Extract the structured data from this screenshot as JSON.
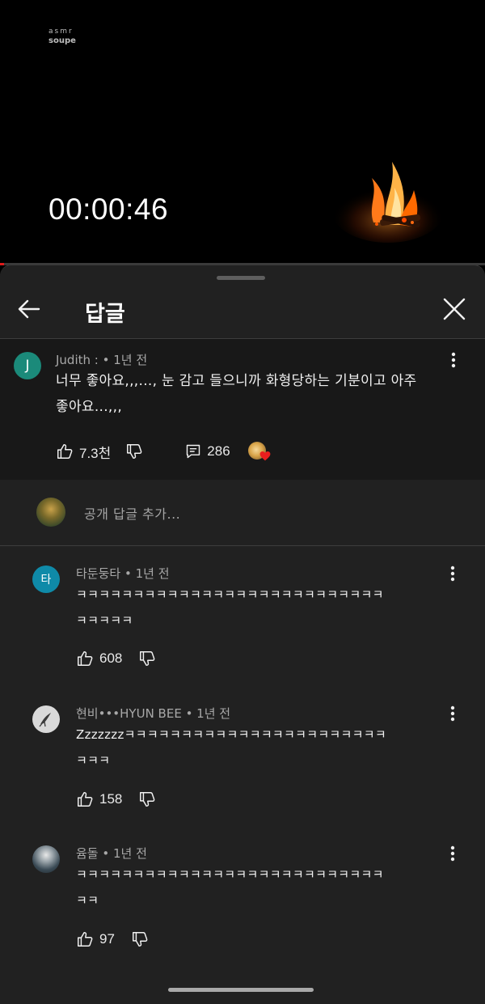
{
  "video": {
    "brand_line1": "asmr",
    "brand_line2": "soupe",
    "timer": "00:00:46"
  },
  "header": {
    "title": "답글"
  },
  "parent_comment": {
    "avatar_letter": "J",
    "avatar_color": "#1b8a7a",
    "meta": "Judith : • 1년 전",
    "text_line1": "너무 좋아요,,,..., 눈 감고 들으니까 화형당하는 기분이고 아주",
    "text_line2": "좋아요...,,,",
    "likes": "7.3천",
    "reply_count": "286"
  },
  "add_reply": {
    "placeholder": "공개 답글 추가..."
  },
  "replies": [
    {
      "avatar_letter": "타",
      "avatar_color": "#0f8aa8",
      "meta": "타둔둥타 • 1년 전",
      "text_line1": "ㅋㅋㅋㅋㅋㅋㅋㅋㅋㅋㅋㅋㅋㅋㅋㅋㅋㅋㅋㅋㅋㅋㅋㅋㅋㅋㅋ",
      "text_line2": "ㅋㅋㅋㅋㅋ",
      "likes": "608"
    },
    {
      "avatar_letter": "",
      "avatar_color": "#d9d9d9",
      "meta": "현비•••HYUN BEE • 1년 전",
      "text_line1": "Zzzzzzzㅋㅋㅋㅋㅋㅋㅋㅋㅋㅋㅋㅋㅋㅋㅋㅋㅋㅋㅋㅋㅋㅋㅋ",
      "text_line2": "ㅋㅋㅋ",
      "likes": "158"
    },
    {
      "avatar_letter": "",
      "avatar_color": "#3a4a55",
      "meta": "윰돌 • 1년 전",
      "text_line1": "ㅋㅋㅋㅋㅋㅋㅋㅋㅋㅋㅋㅋㅋㅋㅋㅋㅋㅋㅋㅋㅋㅋㅋㅋㅋㅋㅋ",
      "text_line2": "ㅋㅋ",
      "likes": "97"
    }
  ],
  "icons": {
    "back": "back-arrow-icon",
    "close": "close-icon",
    "like": "thumbs-up-icon",
    "dislike": "thumbs-down-icon",
    "reply": "comment-icon",
    "more": "more-vert-icon",
    "creator_heart": "creator-heart-icon"
  },
  "colors": {
    "accent_red": "#e01b1b",
    "panel_bg": "#212121",
    "parent_bg": "#181818"
  }
}
